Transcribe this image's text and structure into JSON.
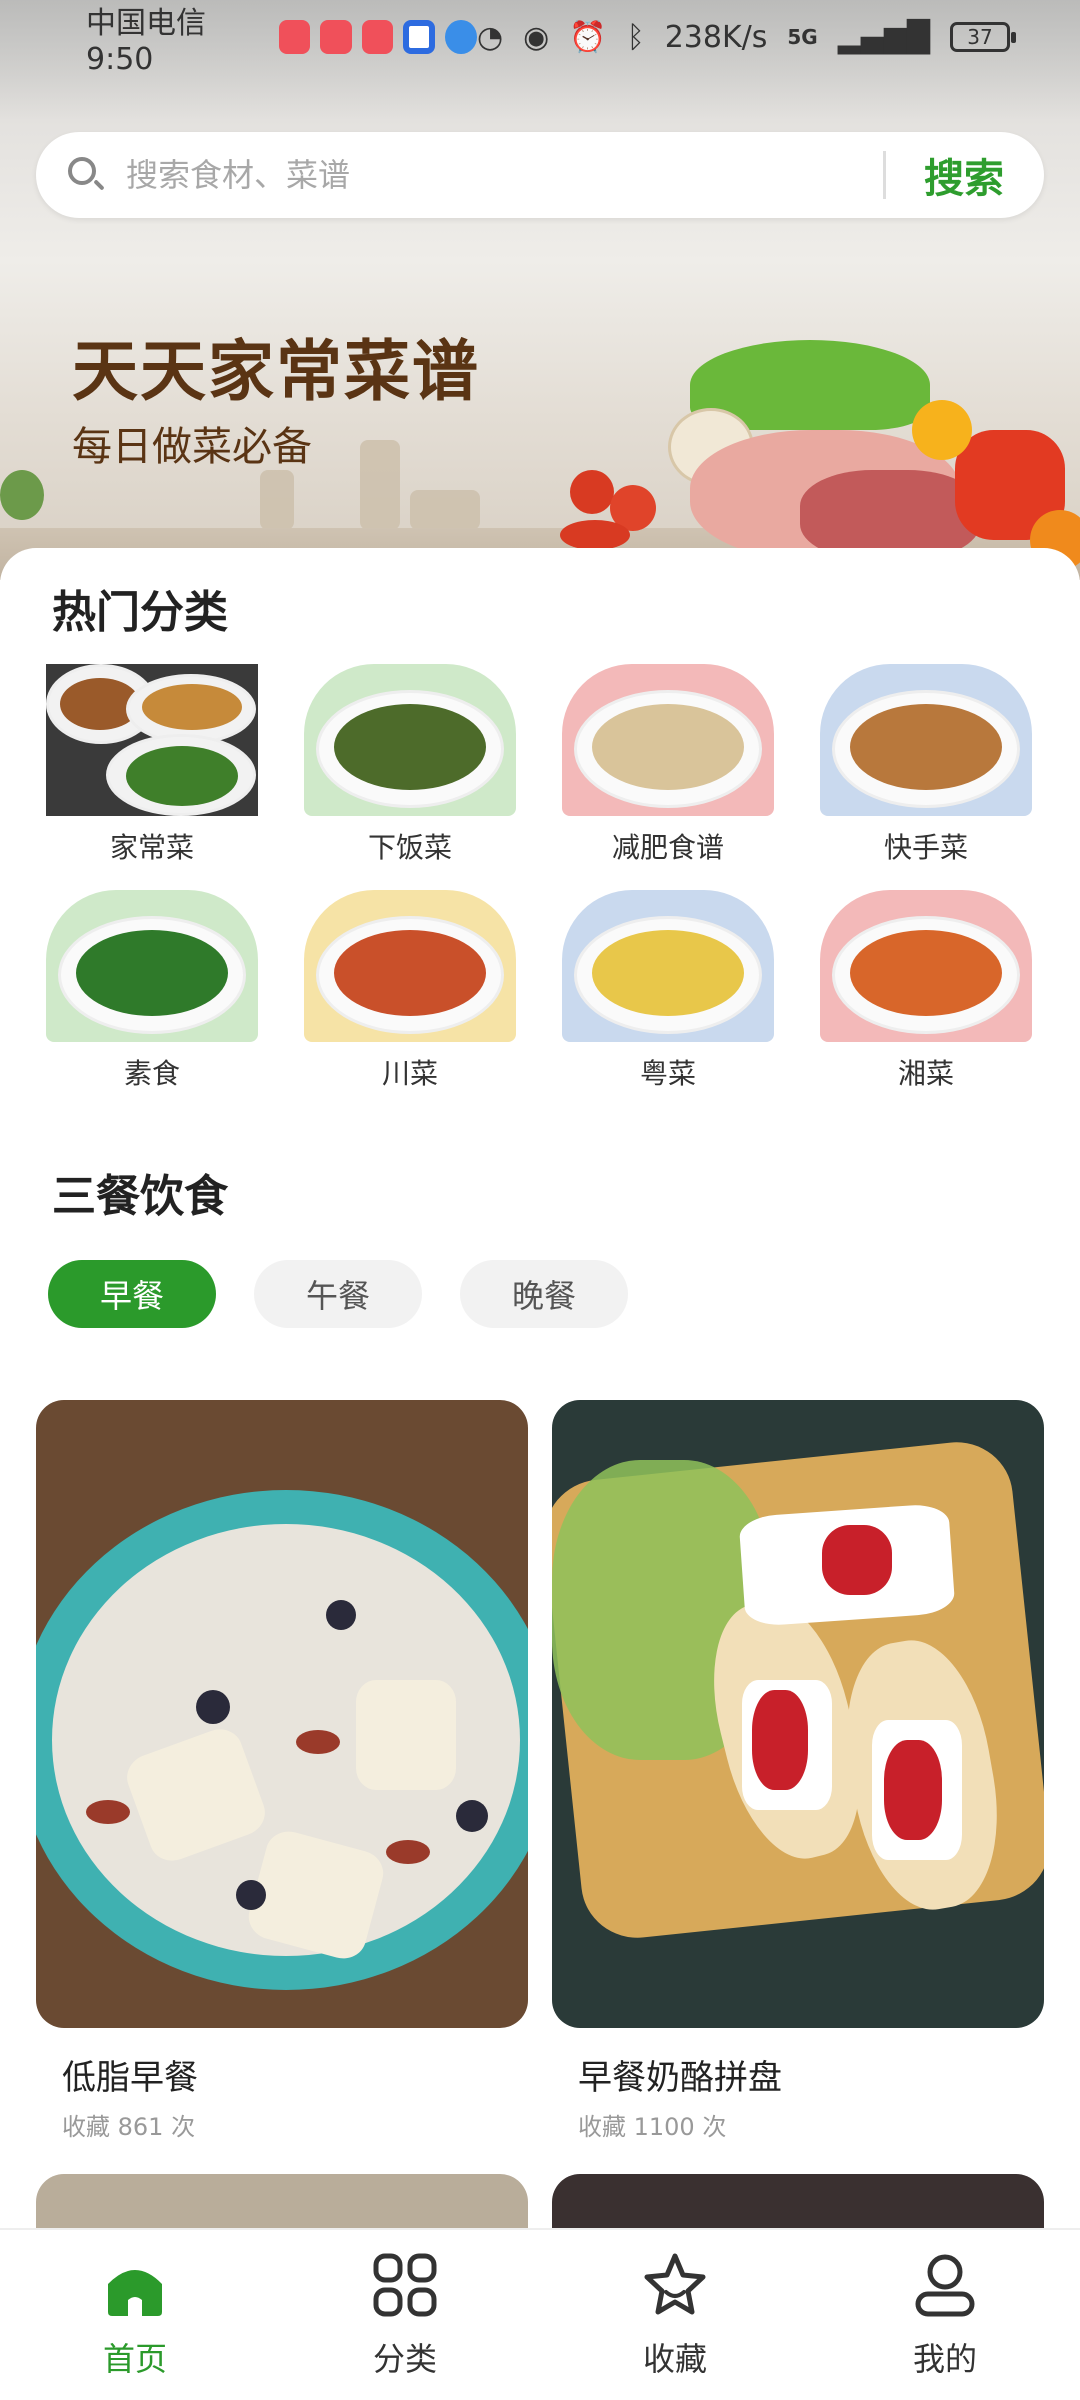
{
  "status_bar": {
    "carrier_time": "中国电信 9:50",
    "network_speed": "238K/s",
    "signal": "5G",
    "battery": "37",
    "app_icon_colors": [
      "#f0505a",
      "#f0505a",
      "#f0505a",
      "#2d6be0",
      "#3a8ee8"
    ]
  },
  "search": {
    "placeholder": "搜索食材、菜谱",
    "button_label": "搜索"
  },
  "hero": {
    "title": "天天家常菜谱",
    "subtitle": "每日做菜必备"
  },
  "hot_categories": {
    "title": "热门分类",
    "items": [
      {
        "label": "家常菜",
        "bg": "#3a3a3a",
        "food": "#9a5a2a"
      },
      {
        "label": "下饭菜",
        "bg": "#cfe9c9",
        "food": "#4d6b2a"
      },
      {
        "label": "减肥食谱",
        "bg": "#f3b9b9",
        "food": "#d9c49a"
      },
      {
        "label": "快手菜",
        "bg": "#c9d9ee",
        "food": "#b8783c"
      },
      {
        "label": "素食",
        "bg": "#cfe9c9",
        "food": "#2f7a2a"
      },
      {
        "label": "川菜",
        "bg": "#f6e3a6",
        "food": "#c9502a"
      },
      {
        "label": "粤菜",
        "bg": "#c9d9ee",
        "food": "#e8c74a"
      },
      {
        "label": "湘菜",
        "bg": "#f3b9b9",
        "food": "#d8662a"
      }
    ]
  },
  "meals": {
    "title": "三餐饮食",
    "tabs": [
      {
        "label": "早餐",
        "active": true
      },
      {
        "label": "午餐",
        "active": false
      },
      {
        "label": "晚餐",
        "active": false
      }
    ],
    "cards": [
      {
        "name": "低脂早餐",
        "favorites": "收藏 861 次"
      },
      {
        "name": "早餐奶酪拼盘",
        "favorites": "收藏 1100 次"
      }
    ]
  },
  "bottom_nav": {
    "items": [
      {
        "label": "首页",
        "icon": "home-icon",
        "active": true
      },
      {
        "label": "分类",
        "icon": "grid-icon",
        "active": false
      },
      {
        "label": "收藏",
        "icon": "star-icon",
        "active": false
      },
      {
        "label": "我的",
        "icon": "user-icon",
        "active": false
      }
    ]
  },
  "colors": {
    "accent": "#2b9a2b",
    "title_brown": "#5a3414"
  }
}
